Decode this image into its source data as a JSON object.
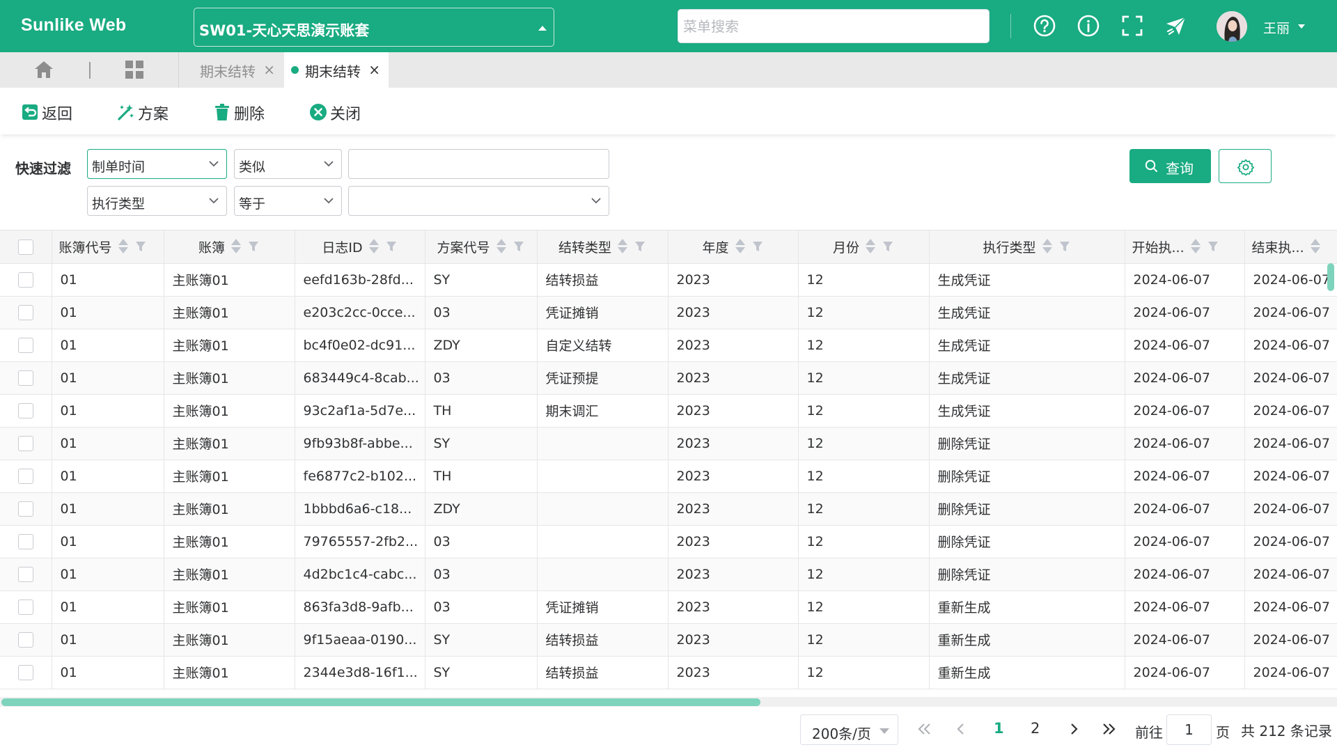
{
  "header": {
    "brand": "Sunlike Web",
    "account_book": "SW01-天心天思演示账套",
    "menu_search_placeholder": "菜单搜索",
    "username": "王丽",
    "icons": [
      "help-circle-icon",
      "info-circle-icon",
      "fullscreen-icon",
      "plane-icon"
    ],
    "brand_color": "#19ab81"
  },
  "tabs": {
    "items": [
      {
        "label": "期末结转",
        "active": false
      },
      {
        "label": "期末结转",
        "active": true
      }
    ]
  },
  "toolbar": {
    "back": "返回",
    "scheme": "方案",
    "delete": "删除",
    "close": "关闭"
  },
  "filter": {
    "title": "快速过滤",
    "row1": {
      "field": "制单时间",
      "operator": "类似",
      "value": ""
    },
    "row2": {
      "field": "执行类型",
      "operator": "等于",
      "value": ""
    },
    "query_button": "查询"
  },
  "table": {
    "columns": [
      "账簿代号",
      "账簿",
      "日志ID",
      "方案代号",
      "结转类型",
      "年度",
      "月份",
      "执行类型",
      "开始执...",
      "结束执..."
    ],
    "rows": [
      [
        "01",
        "主账簿01",
        "eefd163b-28fd...",
        "SY",
        "结转损益",
        "2023",
        "12",
        "生成凭证",
        "2024-06-07",
        "2024-06-07"
      ],
      [
        "01",
        "主账簿01",
        "e203c2cc-0cce...",
        "03",
        "凭证摊销",
        "2023",
        "12",
        "生成凭证",
        "2024-06-07",
        "2024-06-07"
      ],
      [
        "01",
        "主账簿01",
        "bc4f0e02-dc91...",
        "ZDY",
        "自定义结转",
        "2023",
        "12",
        "生成凭证",
        "2024-06-07",
        "2024-06-07"
      ],
      [
        "01",
        "主账簿01",
        "683449c4-8cab...",
        "03",
        "凭证预提",
        "2023",
        "12",
        "生成凭证",
        "2024-06-07",
        "2024-06-07"
      ],
      [
        "01",
        "主账簿01",
        "93c2af1a-5d7e...",
        "TH",
        "期末调汇",
        "2023",
        "12",
        "生成凭证",
        "2024-06-07",
        "2024-06-07"
      ],
      [
        "01",
        "主账簿01",
        "9fb93b8f-abbe...",
        "SY",
        "",
        "2023",
        "12",
        "删除凭证",
        "2024-06-07",
        "2024-06-07"
      ],
      [
        "01",
        "主账簿01",
        "fe6877c2-b102...",
        "TH",
        "",
        "2023",
        "12",
        "删除凭证",
        "2024-06-07",
        "2024-06-07"
      ],
      [
        "01",
        "主账簿01",
        "1bbbd6a6-c18...",
        "ZDY",
        "",
        "2023",
        "12",
        "删除凭证",
        "2024-06-07",
        "2024-06-07"
      ],
      [
        "01",
        "主账簿01",
        "79765557-2fb2...",
        "03",
        "",
        "2023",
        "12",
        "删除凭证",
        "2024-06-07",
        "2024-06-07"
      ],
      [
        "01",
        "主账簿01",
        "4d2bc1c4-cabc...",
        "03",
        "",
        "2023",
        "12",
        "删除凭证",
        "2024-06-07",
        "2024-06-07"
      ],
      [
        "01",
        "主账簿01",
        "863fa3d8-9afb...",
        "03",
        "凭证摊销",
        "2023",
        "12",
        "重新生成",
        "2024-06-07",
        "2024-06-07"
      ],
      [
        "01",
        "主账簿01",
        "9f15aeaa-0190...",
        "SY",
        "结转损益",
        "2023",
        "12",
        "重新生成",
        "2024-06-07",
        "2024-06-07"
      ],
      [
        "01",
        "主账簿01",
        "2344e3d8-16f1...",
        "SY",
        "结转损益",
        "2023",
        "12",
        "重新生成",
        "2024-06-07",
        "2024-06-07"
      ]
    ]
  },
  "pagination": {
    "page_size": "200条/页",
    "pages": [
      "1",
      "2"
    ],
    "current_page": "1",
    "goto_label": "前往",
    "goto_value": "1",
    "page_unit": "页",
    "total": "共 212 条记录"
  }
}
